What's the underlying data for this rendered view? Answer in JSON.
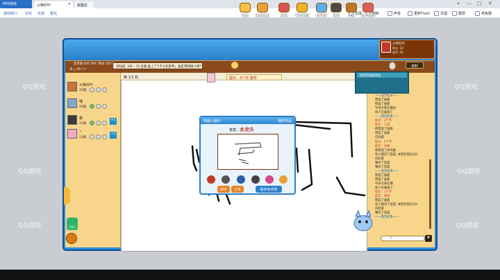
{
  "browser": {
    "app_title": "咔咔游戏",
    "tabs": [
      {
        "label": "火柴红叶",
        "active": true
      },
      {
        "label": "绘图达人…",
        "active": false
      }
    ],
    "menu": [
      "游戏窗口",
      "论坛",
      "充值",
      "重玩"
    ],
    "toolbar": [
      "全屏",
      "刷新",
      "声音",
      "重新Flash",
      "清理",
      "截屏",
      "老板键"
    ]
  },
  "watermark": "QQ游戏",
  "game": {
    "top_icons": [
      "公告",
      "游戏任务",
      "画吧",
      "每日奖励",
      "排行榜",
      "商城",
      "背包",
      "道具精选"
    ],
    "profile": {
      "name": "火柴红叶",
      "stat1": "积分: 10",
      "stat2": "金币: 20"
    },
    "score_line": "金币值:300 700 / 积分 2/0 01",
    "score_line2": "点 △ 00 /  ⊙",
    "room_text": "【绘画】3号— 问 豆腐 画上了5卡七彩卧鸭，画走用四级人啊？",
    "vip_button": "资料",
    "vip_line": "当前开局描述前",
    "hint_label": "提示：3个字,建材",
    "canvas_head": "第 1/1 轮",
    "players": [
      {
        "name": "火柴红叶",
        "level": "22级"
      },
      {
        "name": "喵",
        "level": "10级"
      },
      {
        "name": "像",
        "level": "11级"
      },
      {
        "name": "<",
        "level": "13级"
      }
    ],
    "player_plus": "+1",
    "chat_lines": [
      "一一回合结束一一",
      "赞美了画板",
      "赞美了画板",
      "今日大家在猜金",
      "别人在画画了",
      "一一回合结束一一",
      "提示：3个字",
      "提示：工具",
      "你赞美了画板",
      "赞美了画板",
      "自动提",
      "提示：2个字",
      "提示：动物",
      "被赞美了你的画",
      "有人猜对了答案, 本回合得分2分",
      "内结束",
      "猜对了答案",
      "猜对了答案",
      "一一回合结束一一",
      "赞美了画板",
      "赞美了画板",
      "今日大家在猜",
      "别人在画画了",
      "提示：3个字",
      "提示：建材",
      "赞美了画板",
      "有人猜对了答案, 本回合得分2分",
      "内结束",
      "猜对了答案",
      "一一回合结束一一"
    ],
    "badge1_label": "FAG",
    "dialog": {
      "title": "绘画入画计",
      "close": "我的作品",
      "answer_label": "答案：",
      "answer": "水龙头",
      "btn_save": "保存",
      "btn_share": "分享",
      "btn_local": "保存到本地"
    }
  },
  "colors": {
    "frame": "#2c8cd8",
    "panel": "#f7d68c",
    "accent": "#c0392b"
  }
}
